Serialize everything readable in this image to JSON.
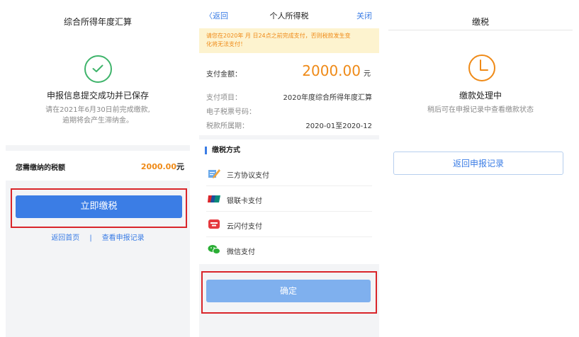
{
  "screen1": {
    "title": "综合所得年度汇算",
    "success_heading": "申报信息提交成功并已保存",
    "notice_line1": "请在2021年6月30日前完成缴款,",
    "notice_line2": "逾期将会产生滞纳金。",
    "tax_label": "您需缴纳的税额",
    "tax_amount": "2000.00",
    "tax_unit": "元",
    "pay_button": "立即缴税",
    "link_home": "返回首页",
    "link_separator": "|",
    "link_records": "查看申报记录",
    "colors": {
      "accent": "#3b7de5",
      "amount": "#ef8a17",
      "success": "#3fb46b",
      "highlight_box": "#d9252a"
    }
  },
  "screen2": {
    "nav": {
      "back": "〈返回",
      "title": "个人所得税",
      "close": "关闭"
    },
    "notice_line1": "请您在2020年  月  日24点之前完成支付，否则税款发生变",
    "notice_line2": "化将无法支付！",
    "pay_amount_label": "支付金额：",
    "pay_amount": "2000.00",
    "pay_amount_unit": "元",
    "details": [
      {
        "key": "支付项目：",
        "value": "2020年度综合所得年度汇算"
      },
      {
        "key": "电子税票号码：",
        "value": ""
      },
      {
        "key": "税款所属期：",
        "value": "2020-01至2020-12"
      }
    ],
    "section_title": "缴税方式",
    "methods": [
      {
        "label": "三方协议支付",
        "icon": "pen-paper-icon"
      },
      {
        "label": "银联卡支付",
        "icon": "unionpay-icon"
      },
      {
        "label": "云闪付支付",
        "icon": "quickpass-icon"
      },
      {
        "label": "微信支付",
        "icon": "wechat-icon"
      }
    ],
    "confirm_button": "确定"
  },
  "screen3": {
    "title": "缴税",
    "status_heading": "缴款处理中",
    "status_sub": "稍后可在申报记录中查看缴款状态",
    "back_button": "返回申报记录",
    "icon": "clock-icon"
  }
}
